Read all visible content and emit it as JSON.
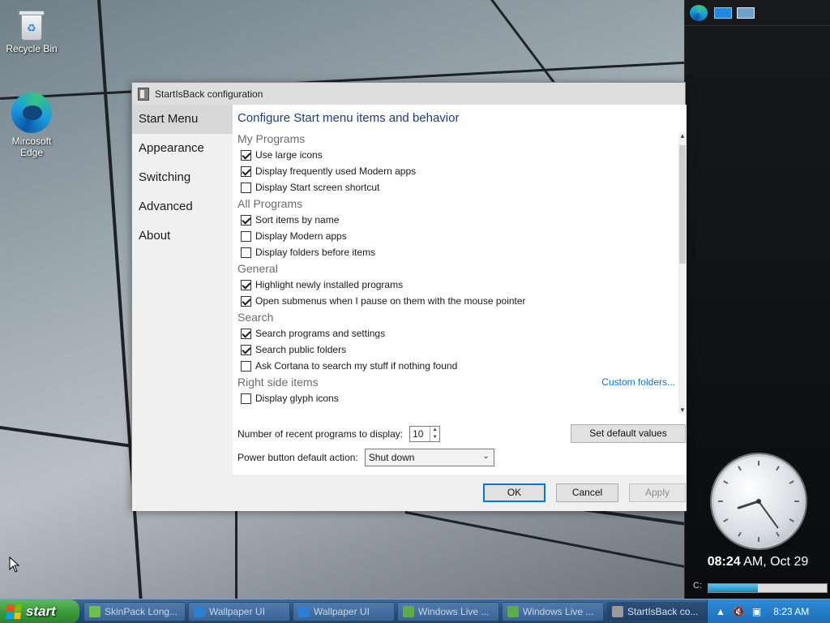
{
  "desktop": {
    "icons": [
      {
        "label": "Recycle Bin",
        "icon": "recycle-bin-icon"
      },
      {
        "label": "Mircosoft Edge",
        "icon": "edge-icon"
      }
    ]
  },
  "sidebar": {
    "top_icons": [
      "edge-icon",
      "screen-icon",
      "display-icon"
    ],
    "clock": {
      "time_bold": "08:24",
      "time_rest": " AM, Oct 29",
      "hour": 8,
      "minute": 24
    },
    "disk": {
      "label": "C:",
      "used_fraction": 0.42
    }
  },
  "window": {
    "title": "StartIsBack configuration",
    "nav": [
      {
        "label": "Start Menu",
        "active": true
      },
      {
        "label": "Appearance",
        "active": false
      },
      {
        "label": "Switching",
        "active": false
      },
      {
        "label": "Advanced",
        "active": false
      },
      {
        "label": "About",
        "active": false
      }
    ],
    "heading": "Configure Start menu items and behavior",
    "sections": [
      {
        "title": "My Programs",
        "items": [
          {
            "label": "Use large icons",
            "checked": true
          },
          {
            "label": "Display frequently used Modern apps",
            "checked": true
          },
          {
            "label": "Display Start screen shortcut",
            "checked": false
          }
        ]
      },
      {
        "title": "All Programs",
        "items": [
          {
            "label": "Sort items by name",
            "checked": true
          },
          {
            "label": "Display Modern apps",
            "checked": false
          },
          {
            "label": "Display folders before items",
            "checked": false
          }
        ]
      },
      {
        "title": "General",
        "items": [
          {
            "label": "Highlight newly installed programs",
            "checked": true
          },
          {
            "label": "Open submenus when I pause on them with the mouse pointer",
            "checked": true
          }
        ]
      },
      {
        "title": "Search",
        "items": [
          {
            "label": "Search programs and settings",
            "checked": true
          },
          {
            "label": "Search public folders",
            "checked": true
          },
          {
            "label": "Ask Cortana to search my stuff if nothing found",
            "checked": false
          }
        ]
      },
      {
        "title": "Right side items",
        "link": "Custom folders...",
        "items": [
          {
            "label": "Display glyph icons",
            "checked": false
          }
        ]
      }
    ],
    "recent_label": "Number of recent programs to display:",
    "recent_value": "10",
    "set_default_label": "Set default values",
    "power_label": "Power button default action:",
    "power_value": "Shut down",
    "ok_label": "OK",
    "cancel_label": "Cancel",
    "apply_label": "Apply"
  },
  "taskbar": {
    "start_label": "start",
    "tasks": [
      {
        "label": "SkinPack Long...",
        "active": false,
        "color": "#6fbf4f"
      },
      {
        "label": "Wallpaper UI",
        "active": false,
        "color": "#2c7fd0"
      },
      {
        "label": "Wallpaper UI",
        "active": false,
        "color": "#2c7fd0"
      },
      {
        "label": "Windows Live ...",
        "active": false,
        "color": "#5cae4a"
      },
      {
        "label": "Windows Live ...",
        "active": false,
        "color": "#5cae4a"
      },
      {
        "label": "StartIsBack co...",
        "active": true,
        "color": "#9a9a9a"
      }
    ],
    "tray_time": "8:23 AM"
  }
}
